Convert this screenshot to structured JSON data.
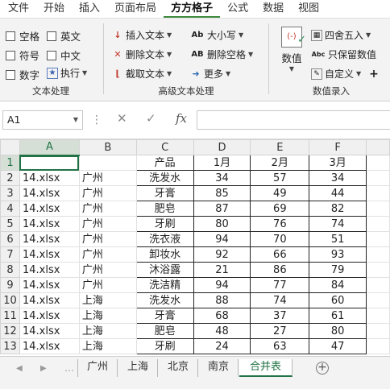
{
  "ribbon_tabs": [
    "文件",
    "开始",
    "插入",
    "页面布局",
    "方方格子",
    "公式",
    "数据",
    "视图"
  ],
  "active_tab": "方方格子",
  "text_processing": {
    "label": "文本处理",
    "checkboxes": [
      "空格",
      "英文",
      "符号",
      "中文",
      "数字"
    ],
    "execute": "执行"
  },
  "advanced_text": {
    "label": "高级文本处理",
    "insert_text": "插入文本",
    "delete_text": "删除文本",
    "extract_text": "截取文本",
    "case": "大小写",
    "delete_spaces": "删除空格",
    "more": "更多"
  },
  "numeric_entry": {
    "label": "数值录入",
    "numeric": "数值",
    "round": "四舍五入",
    "keep_value": "只保留数值",
    "custom": "自定义"
  },
  "formula_bar": {
    "name_box": "A1",
    "formula": ""
  },
  "columns": [
    "A",
    "B",
    "C",
    "D",
    "E",
    "F"
  ],
  "rows": [
    {
      "n": "1",
      "a": "",
      "b": "",
      "c": "产品",
      "d": "1月",
      "e": "2月",
      "f": "3月"
    },
    {
      "n": "2",
      "a": "14.xlsx",
      "b": "广州",
      "c": "洗发水",
      "d": "34",
      "e": "57",
      "f": "34"
    },
    {
      "n": "3",
      "a": "14.xlsx",
      "b": "广州",
      "c": "牙膏",
      "d": "85",
      "e": "49",
      "f": "44"
    },
    {
      "n": "4",
      "a": "14.xlsx",
      "b": "广州",
      "c": "肥皂",
      "d": "87",
      "e": "69",
      "f": "82"
    },
    {
      "n": "5",
      "a": "14.xlsx",
      "b": "广州",
      "c": "牙刷",
      "d": "80",
      "e": "76",
      "f": "74"
    },
    {
      "n": "6",
      "a": "14.xlsx",
      "b": "广州",
      "c": "洗衣液",
      "d": "94",
      "e": "70",
      "f": "51"
    },
    {
      "n": "7",
      "a": "14.xlsx",
      "b": "广州",
      "c": "卸妆水",
      "d": "92",
      "e": "66",
      "f": "93"
    },
    {
      "n": "8",
      "a": "14.xlsx",
      "b": "广州",
      "c": "沐浴露",
      "d": "21",
      "e": "86",
      "f": "79"
    },
    {
      "n": "9",
      "a": "14.xlsx",
      "b": "广州",
      "c": "洗洁精",
      "d": "94",
      "e": "77",
      "f": "84"
    },
    {
      "n": "10",
      "a": "14.xlsx",
      "b": "上海",
      "c": "洗发水",
      "d": "88",
      "e": "74",
      "f": "60"
    },
    {
      "n": "11",
      "a": "14.xlsx",
      "b": "上海",
      "c": "牙膏",
      "d": "68",
      "e": "37",
      "f": "61"
    },
    {
      "n": "12",
      "a": "14.xlsx",
      "b": "上海",
      "c": "肥皂",
      "d": "48",
      "e": "27",
      "f": "80"
    },
    {
      "n": "13",
      "a": "14.xlsx",
      "b": "上海",
      "c": "牙刷",
      "d": "24",
      "e": "63",
      "f": "47"
    }
  ],
  "sheet_tabs": [
    "广州",
    "上海",
    "北京",
    "南京",
    "合并表"
  ],
  "active_sheet": "合并表",
  "colors": {
    "accent": "#217346",
    "ribbon_bg": "#f3f3f3"
  }
}
